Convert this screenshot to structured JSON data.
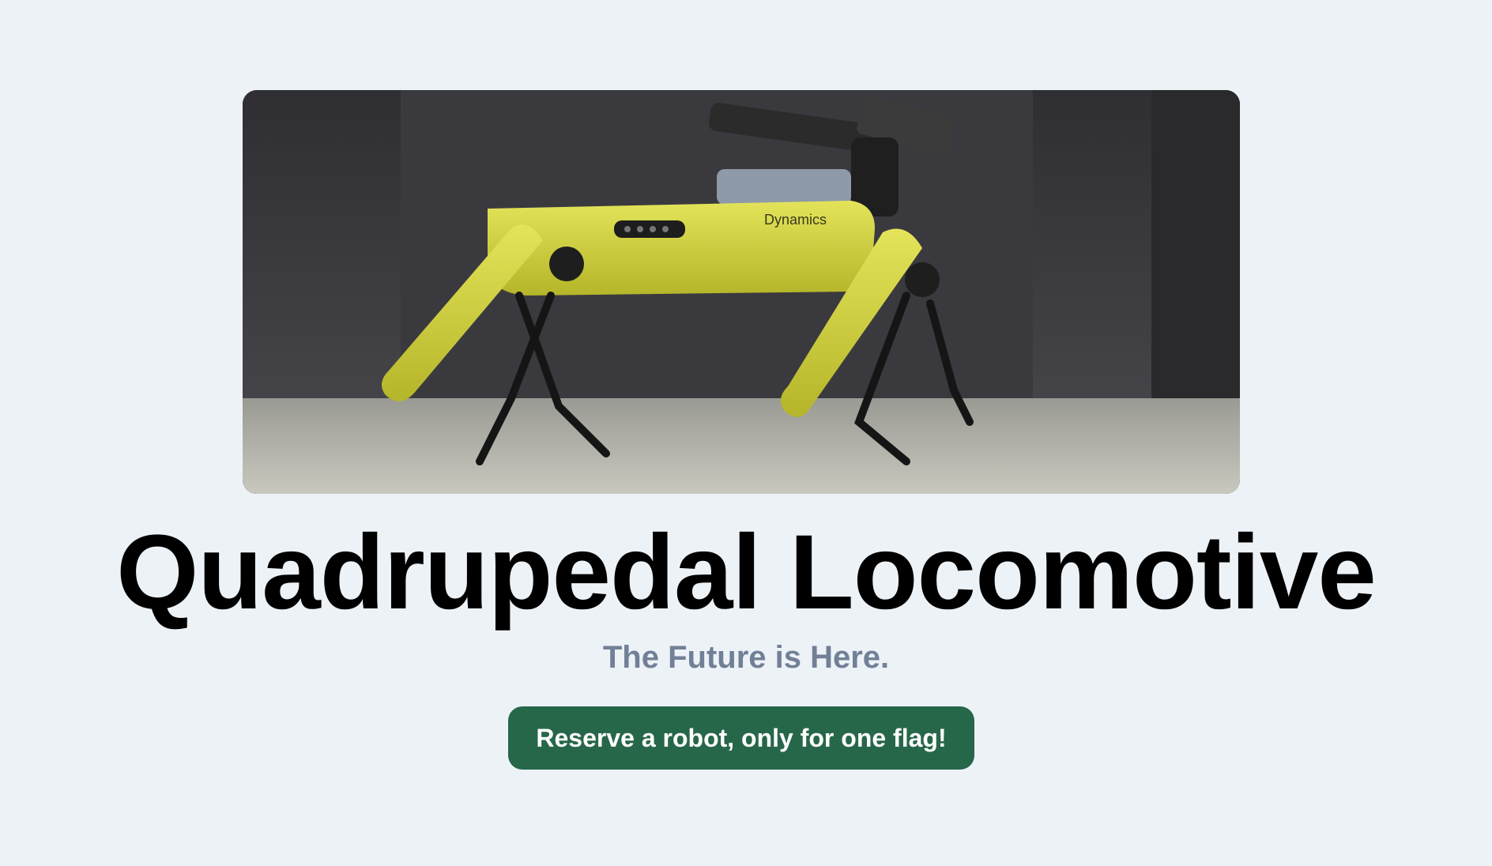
{
  "hero": {
    "image_alt": "Yellow quadruped robot walking",
    "image_brand_text": "Dynamics",
    "title": "Quadrupedal Locomotive",
    "subtitle": "The Future is Here."
  },
  "cta": {
    "label": "Reserve a robot, only for one flag!"
  },
  "colors": {
    "background": "#edf2f7",
    "title": "#000000",
    "subtitle": "#718096",
    "button_bg": "#276749",
    "button_text": "#ffffff",
    "robot_body": "#d8d83a"
  }
}
